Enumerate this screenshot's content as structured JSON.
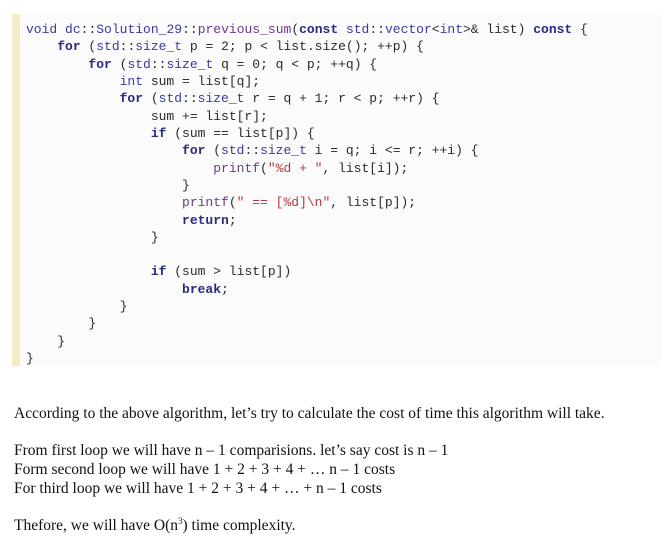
{
  "code": {
    "lines": [
      "void dc::Solution_29::previous_sum(const std::vector<int>& list) const {",
      "    for (std::size_t p = 2; p < list.size(); ++p) {",
      "        for (std::size_t q = 0; q < p; ++q) {",
      "            int sum = list[q];",
      "            for (std::size_t r = q + 1; r < p; ++r) {",
      "                sum += list[r];",
      "                if (sum == list[p]) {",
      "                    for (std::size_t i = q; i <= r; ++i) {",
      "                        printf(\"%d + \", list[i]);",
      "                    }",
      "                    printf(\" == [%d]\\n\", list[p]);",
      "                    return;",
      "                }",
      "",
      "                if (sum > list[p])",
      "                    break;",
      "            }",
      "        }",
      "    }",
      "}"
    ]
  },
  "text": {
    "intro": "According to the above algorithm, let’s try to calculate the cost of time this algorithm will take.",
    "line1": "From first loop we will have n – 1 comparisions. let’s say cost is n – 1",
    "line2": "Form second loop we will have 1 + 2 + 3 + 4 + … n – 1 costs",
    "line3": "For third loop we will have 1 + 2 + 3 + 4 + … + n – 1 costs",
    "conclusion_prefix": "Thefore, we will have O(n",
    "conclusion_sup": "3",
    "conclusion_suffix": ") time complexity."
  }
}
